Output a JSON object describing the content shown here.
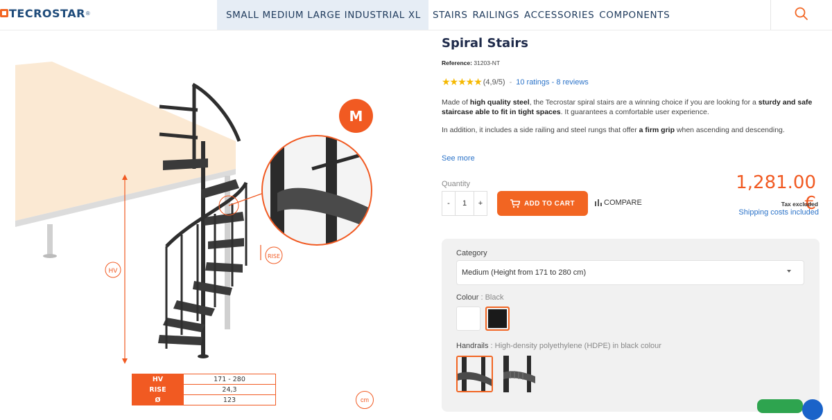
{
  "header": {
    "logo_text": "TECROSTAR",
    "logo_reg": "®",
    "size_nav": [
      "SMALL",
      "MEDIUM",
      "LARGE",
      "INDUSTRIAL",
      "XL"
    ],
    "category_nav": [
      "STAIRS",
      "RAILINGS",
      "ACCESSORIES",
      "COMPONENTS"
    ],
    "search_icon": "search-icon"
  },
  "image": {
    "size_badge": "M",
    "hv_label": "HV",
    "rise_label": "RISE",
    "spec_table": [
      {
        "key": "HV",
        "value": "171 - 280"
      },
      {
        "key": "RISE",
        "value": "24,3"
      },
      {
        "key": "Ø",
        "value": "123"
      }
    ],
    "unit_icon": "cm"
  },
  "product": {
    "title": "Spiral Stairs",
    "reference_label": "Reference:",
    "reference": "31203-NT",
    "rating_stars": "★★★★★",
    "rating_score": "(4,9/5)",
    "rating_sep": "-",
    "rating_link": "10 ratings - 8 reviews",
    "desc1_a": "Made of ",
    "desc1_b": "high quality steel",
    "desc1_c": ", the Tecrostar spiral stairs are a winning choice if you are looking for a ",
    "desc1_d": "sturdy and safe staircase able to fit in tight spaces",
    "desc1_e": ". It guarantees a comfortable user experience.",
    "desc2_a": "In addition, it includes a side railing and steel rungs that offer ",
    "desc2_b": "a firm grip",
    "desc2_c": " when ascending and descending.",
    "see_more": "See more",
    "quantity_label": "Quantity",
    "qty_minus": "-",
    "qty_value": "1",
    "qty_plus": "+",
    "add_to_cart": "ADD TO CART",
    "compare": "COMPARE",
    "price": "1,281.00 €",
    "tax": "Tax excluded",
    "shipping": "Shipping costs included"
  },
  "options": {
    "category_label": "Category",
    "category_value": "Medium (Height from 171 to 280 cm)",
    "colour_label": "Colour",
    "colour_value": ": Black",
    "handrails_label": "Handrails",
    "handrails_value": ": High-density polyethylene (HDPE) in black colour"
  },
  "colors": {
    "accent": "#f26522",
    "brand_blue": "#1e4b7a",
    "link": "#2a72c8",
    "star": "#f5b800"
  }
}
